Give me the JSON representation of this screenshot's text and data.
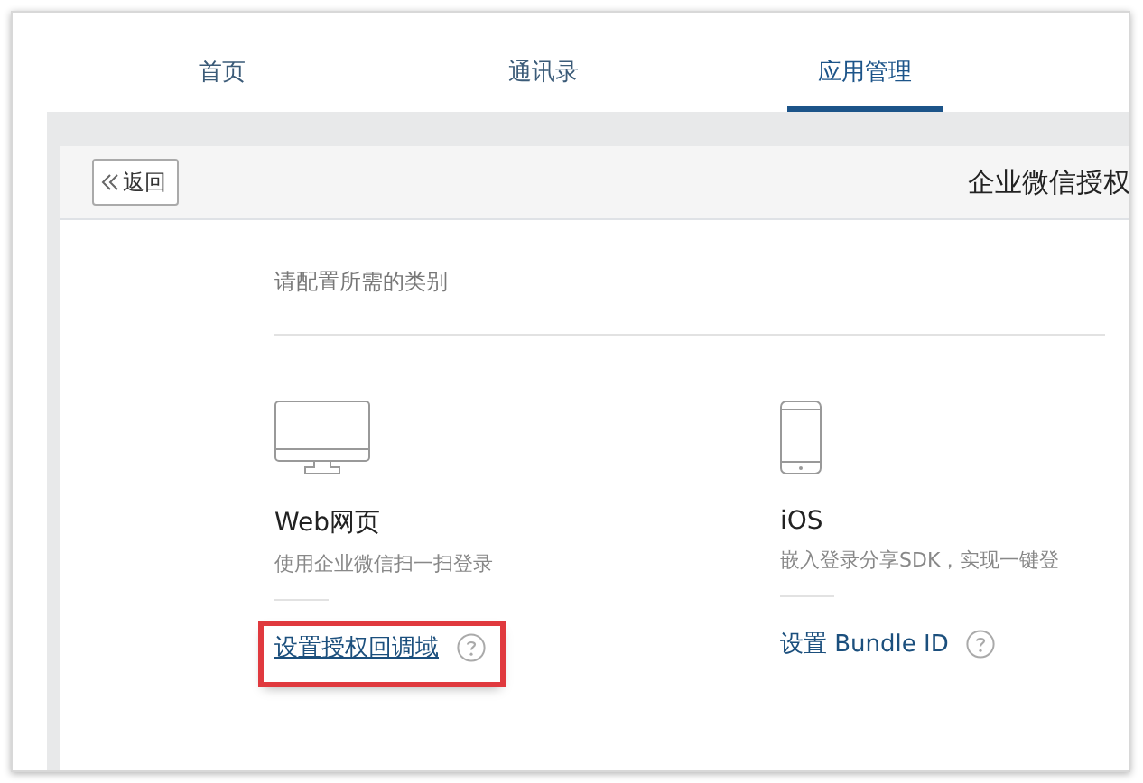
{
  "tabs": [
    {
      "label": "首页",
      "selected": false
    },
    {
      "label": "通讯录",
      "selected": false
    },
    {
      "label": "应用管理",
      "selected": true
    }
  ],
  "header": {
    "back_button": "返回",
    "title": "企业微信授权"
  },
  "prompt": "请配置所需的类别",
  "platforms": [
    {
      "kind": "web",
      "name": "Web网页",
      "description": "使用企业微信扫一扫登录",
      "link": "设置授权回调域",
      "highlighted": true
    },
    {
      "kind": "ios",
      "name": "iOS",
      "description": "嵌入登录分享SDK，实现一键登",
      "link": "设置 Bundle ID",
      "highlighted": false
    }
  ]
}
